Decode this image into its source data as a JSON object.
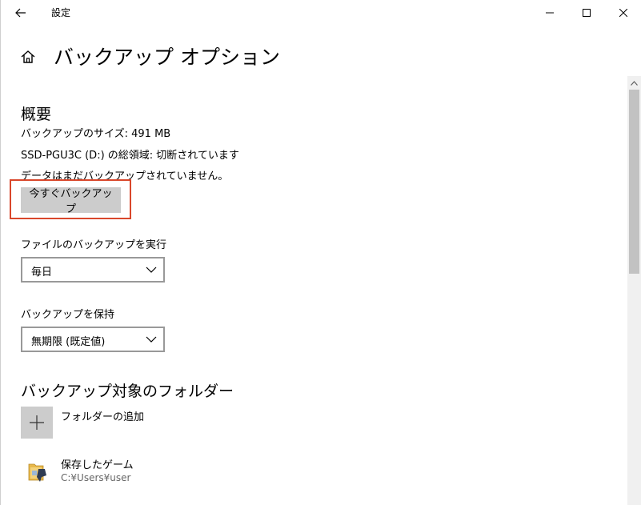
{
  "window": {
    "title": "設定"
  },
  "header": {
    "page_title": "バックアップ オプション"
  },
  "overview": {
    "heading": "概要",
    "backup_size": "バックアップのサイズ: 491 MB",
    "total_space": "SSD-PGU3C (D:) の総領域: 切断されています",
    "status": "データはまだバックアップされていません。",
    "backup_now_label": "今すぐバックアップ"
  },
  "frequency": {
    "label": "ファイルのバックアップを実行",
    "selected": "毎日"
  },
  "retention": {
    "label": "バックアップを保持",
    "selected": "無期限 (既定値)"
  },
  "folders": {
    "heading": "バックアップ対象のフォルダー",
    "add_label": "フォルダーの追加",
    "items": [
      {
        "name": "保存したゲーム",
        "path": "C:¥Users¥user",
        "icon": "saved-games-folder-icon"
      }
    ]
  },
  "colors": {
    "highlight_border": "#d9472b",
    "button_bg": "#cccccc",
    "scroll_thumb": "#c2c2c2"
  }
}
